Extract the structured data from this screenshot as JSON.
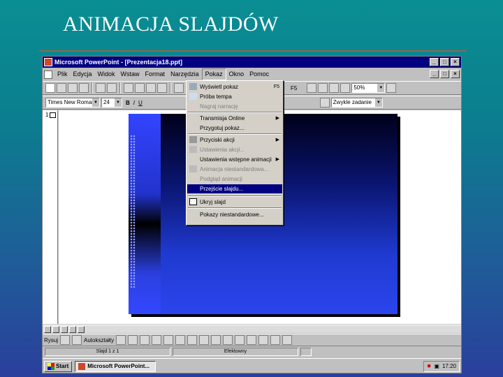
{
  "slide": {
    "title": "ANIMACJA SLAJDÓW"
  },
  "window": {
    "title": "Microsoft PowerPoint - [Prezentacja18.ppt]",
    "controls": [
      "_",
      "□",
      "×"
    ]
  },
  "menubar": {
    "items": [
      "Plik",
      "Edycja",
      "Widok",
      "Wstaw",
      "Format",
      "Narzędzia",
      "Pokaz",
      "Okno",
      "Pomoc"
    ],
    "active_index": 6
  },
  "toolbar": {
    "zoom": "50%",
    "font_name": "Times New Roman",
    "font_size": "24",
    "layout_combo": "Zwykle zadanie",
    "shortcut": "F5",
    "bold": "B",
    "italic": "I",
    "underline": "U"
  },
  "dropdown": {
    "items": [
      {
        "label": "Wyświetl pokaz",
        "shortcut": "F5",
        "disabled": false
      },
      {
        "label": "Próba tempa",
        "disabled": false
      },
      {
        "label": "Nagraj narrację",
        "disabled": true
      },
      {
        "label": "Transmisja Online",
        "submenu": true,
        "disabled": false
      },
      {
        "label": "Przygotuj pokaz...",
        "disabled": false
      },
      {
        "label": "Przyciski akcji",
        "submenu": true,
        "disabled": false
      },
      {
        "label": "Ustawienia akcji...",
        "disabled": true
      },
      {
        "label": "Ustawienia wstępne animacji",
        "submenu": true,
        "disabled": false
      },
      {
        "label": "Animacja niestandardowa...",
        "disabled": true
      },
      {
        "label": "Podgląd animacji",
        "disabled": true
      },
      {
        "label": "Przejście slajdu...",
        "disabled": false,
        "selected": true
      },
      {
        "label": "Ukryj slajd",
        "disabled": false
      },
      {
        "label": "Pokazy niestandardowe...",
        "disabled": false
      }
    ]
  },
  "outline": {
    "slide_number": "1"
  },
  "drawing_toolbar": {
    "draw_label": "Rysuj",
    "autoshapes_label": "Autokształty"
  },
  "statusbar": {
    "slide_info": "Slajd 1 z 1",
    "design": "Efektowny"
  },
  "taskbar": {
    "start": "Start",
    "task": "Microsoft PowerPoint...",
    "clock": "17:20"
  },
  "colors": {
    "titlebar": "#000080",
    "selection": "#000080",
    "background_top": "#0a8e93",
    "background_bottom": "#2a3f9c"
  }
}
